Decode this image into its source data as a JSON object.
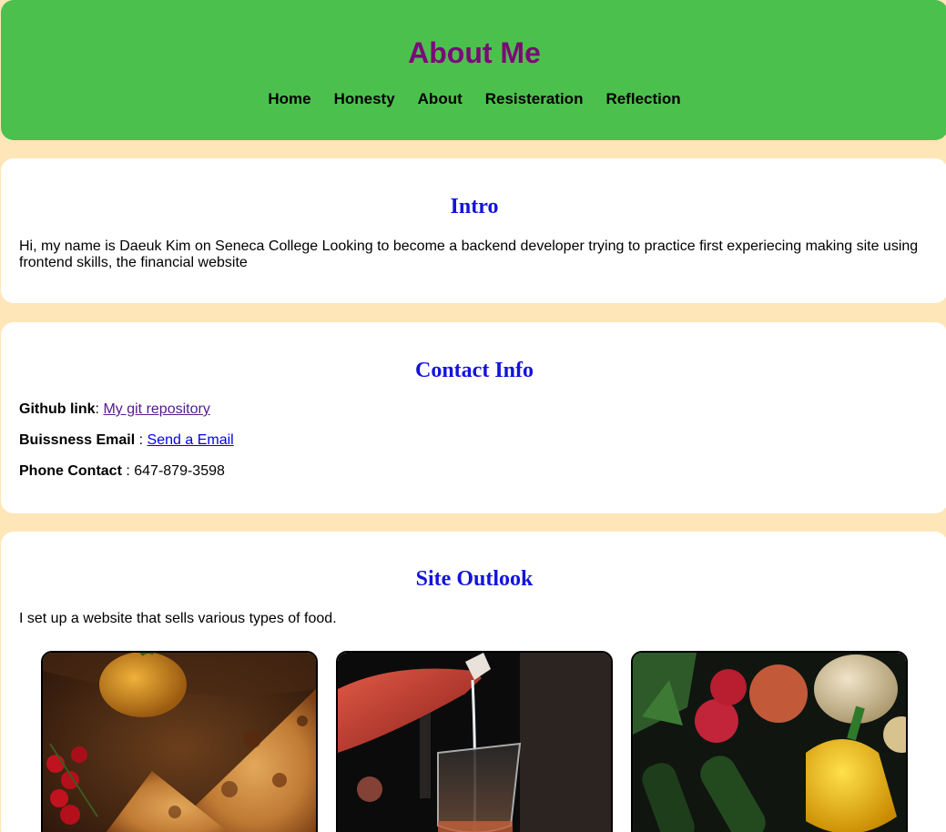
{
  "header": {
    "title": "About Me",
    "nav": [
      "Home",
      "Honesty",
      "About",
      "Resisteration",
      "Reflection"
    ]
  },
  "intro": {
    "heading": "Intro",
    "text": "Hi, my name is Daeuk Kim on Seneca College Looking to become a backend developer trying to practice first experiecing making site using frontend skills, the financial website"
  },
  "contact": {
    "heading": "Contact Info",
    "github_label": "Github link",
    "github_sep": ":",
    "github_link": "My git repository",
    "email_label": "Buissness Email",
    "email_sep": ":",
    "email_link": "Send a Email",
    "phone_label": "Phone Contact",
    "phone_sep": ":",
    "phone_value": "647-879-3598"
  },
  "outlook": {
    "heading": "Site Outlook",
    "text": "I set up a website that sells various types of food.",
    "images": [
      "pizza",
      "wine",
      "vegetables"
    ]
  },
  "colors": {
    "page_bg": "#ffe6b8",
    "header_bg": "#4cc04d",
    "title": "#7a0a78",
    "heading": "#1313dd"
  }
}
